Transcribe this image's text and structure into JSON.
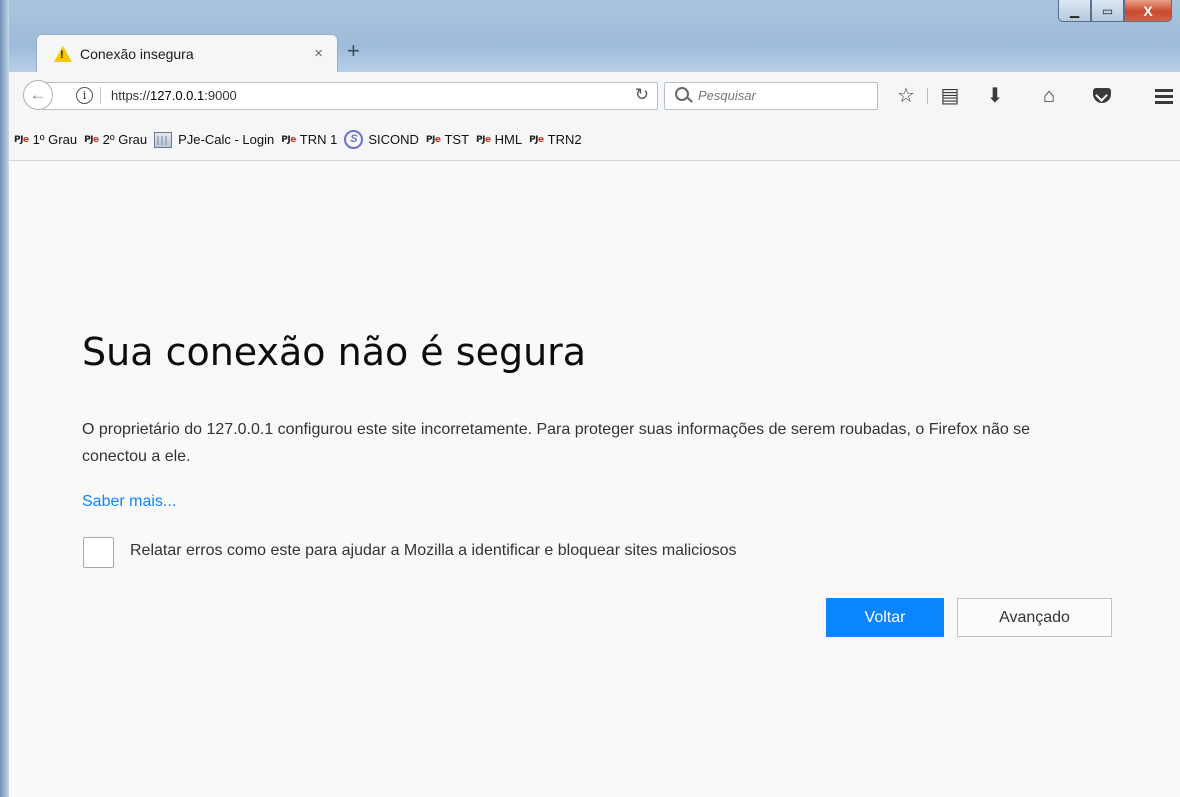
{
  "tab": {
    "title": "Conexão insegura",
    "close": "×",
    "new_tab": "+",
    "warning_glyph": "!"
  },
  "window_controls": {
    "minimize": "▁",
    "maximize": "▭",
    "close": "X"
  },
  "navbar": {
    "back_glyph": "←",
    "url_prefix": "https://",
    "url_host": "127.0.0.1",
    "url_suffix": ":9000",
    "reload_glyph": "↻",
    "search_placeholder": "Pesquisar",
    "info_glyph": "i",
    "icons": [
      "bookmark-star-icon",
      "reading-list-icon",
      "downloads-icon",
      "home-icon",
      "pocket-icon",
      "menu-icon"
    ],
    "star_glyph": "☆",
    "list_glyph": "▤",
    "download_glyph": "⬇",
    "home_glyph": "⌂"
  },
  "bookmarks": [
    {
      "label": "1º Grau",
      "icon": "pje"
    },
    {
      "label": "2º Grau",
      "icon": "pje"
    },
    {
      "label": "PJe-Calc - Login",
      "icon": "calculator"
    },
    {
      "label": "TRN 1",
      "icon": "pje"
    },
    {
      "label": "SICOND",
      "icon": "sicond"
    },
    {
      "label": "TST",
      "icon": "pje"
    },
    {
      "label": "HML",
      "icon": "pje"
    },
    {
      "label": "TRN2",
      "icon": "pje"
    }
  ],
  "pje_icon": {
    "prefix": "PJ",
    "suffix": "e"
  },
  "sicond_glyph": "S",
  "error_page": {
    "title": "Sua conexão não é segura",
    "description": "O proprietário do 127.0.0.1 configurou este site incorretamente. Para proteger suas informações de serem roubadas, o Firefox não se conectou a ele.",
    "learn_more": "Saber mais...",
    "report_checkbox_label": "Relatar erros como este para ajudar a Mozilla a identificar e bloquear sites maliciosos",
    "report_checked": false,
    "back_button": "Voltar",
    "advanced_button": "Avançado"
  },
  "colors": {
    "primary_button": "#0a84ff",
    "link": "#0a84ff",
    "page_bg": "#f9f9fa"
  }
}
